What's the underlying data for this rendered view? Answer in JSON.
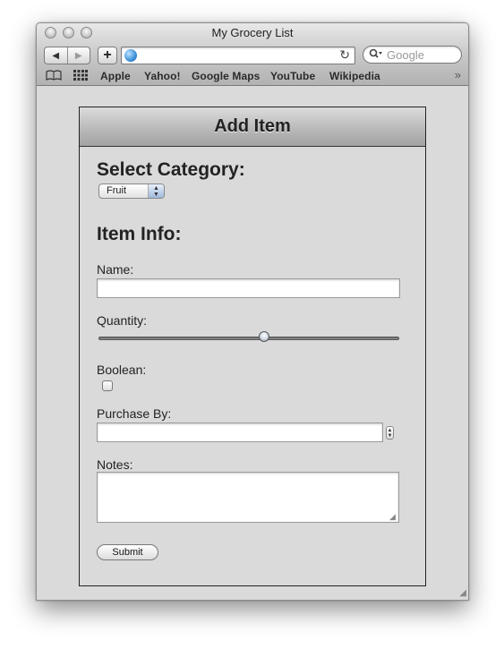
{
  "window": {
    "title": "My Grocery List"
  },
  "toolbar": {
    "back_icon": "◀",
    "forward_icon": "▶",
    "add_icon": "+",
    "reload_icon": "↻",
    "search_icon": "magnifier-icon",
    "search_placeholder": "Google"
  },
  "bookmarks": {
    "items": [
      "Apple",
      "Yahoo!",
      "Google Maps",
      "YouTube",
      "Wikipedia"
    ],
    "more_icon": "»"
  },
  "form": {
    "header_title": "Add Item",
    "category_heading": "Select Category:",
    "category_selected": "Fruit",
    "info_heading": "Item Info:",
    "name_label": "Name:",
    "name_value": "",
    "quantity_label": "Quantity:",
    "quantity_fraction": 0.55,
    "boolean_label": "Boolean:",
    "boolean_checked": false,
    "purchase_label": "Purchase By:",
    "purchase_value": "",
    "notes_label": "Notes:",
    "notes_value": "",
    "submit_label": "Submit"
  },
  "colors": {
    "window_bg": "#dadada",
    "panel_border": "#222222"
  }
}
